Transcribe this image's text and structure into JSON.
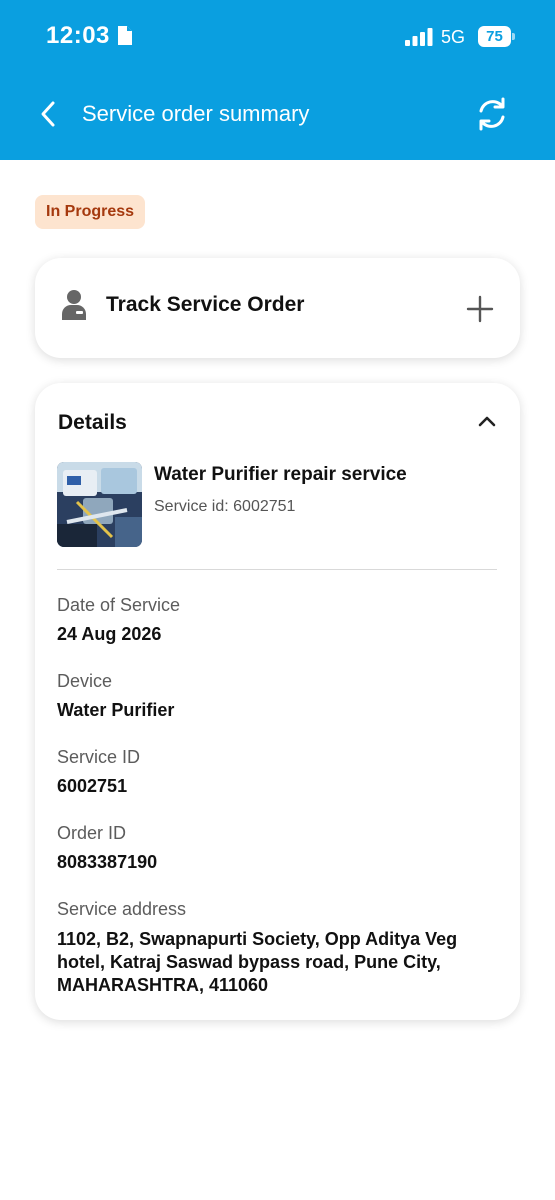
{
  "status_bar": {
    "time": "12:03",
    "network": "5G",
    "battery": "75",
    "icons": [
      "document-icon",
      "signal-icon"
    ]
  },
  "header": {
    "title": "Service order summary",
    "back_icon": "back-arrow-icon",
    "refresh_icon": "refresh-icon",
    "color": "#0a9fe0"
  },
  "status_badge": {
    "label": "In Progress",
    "bg_color": "#fde4cf",
    "text_color": "#a5390e"
  },
  "track_card": {
    "label": "Track Service Order",
    "icon": "person-icon",
    "expand_icon": "plus-icon"
  },
  "details": {
    "title": "Details",
    "collapse_icon": "chevron-up-icon",
    "service_name": "Water Purifier repair service",
    "service_id_line": "Service id: 6002751",
    "fields": [
      {
        "label": "Date of Service",
        "value": "24 Aug 2026"
      },
      {
        "label": "Device",
        "value": "Water Purifier"
      },
      {
        "label": "Service ID",
        "value": "6002751"
      },
      {
        "label": "Order ID",
        "value": "8083387190"
      },
      {
        "label": "Service address",
        "value": "1102, B2, Swapnapurti Society, Opp Aditya Veg hotel, Katraj Saswad bypass road, Pune City, MAHARASHTRA, 411060"
      }
    ]
  }
}
